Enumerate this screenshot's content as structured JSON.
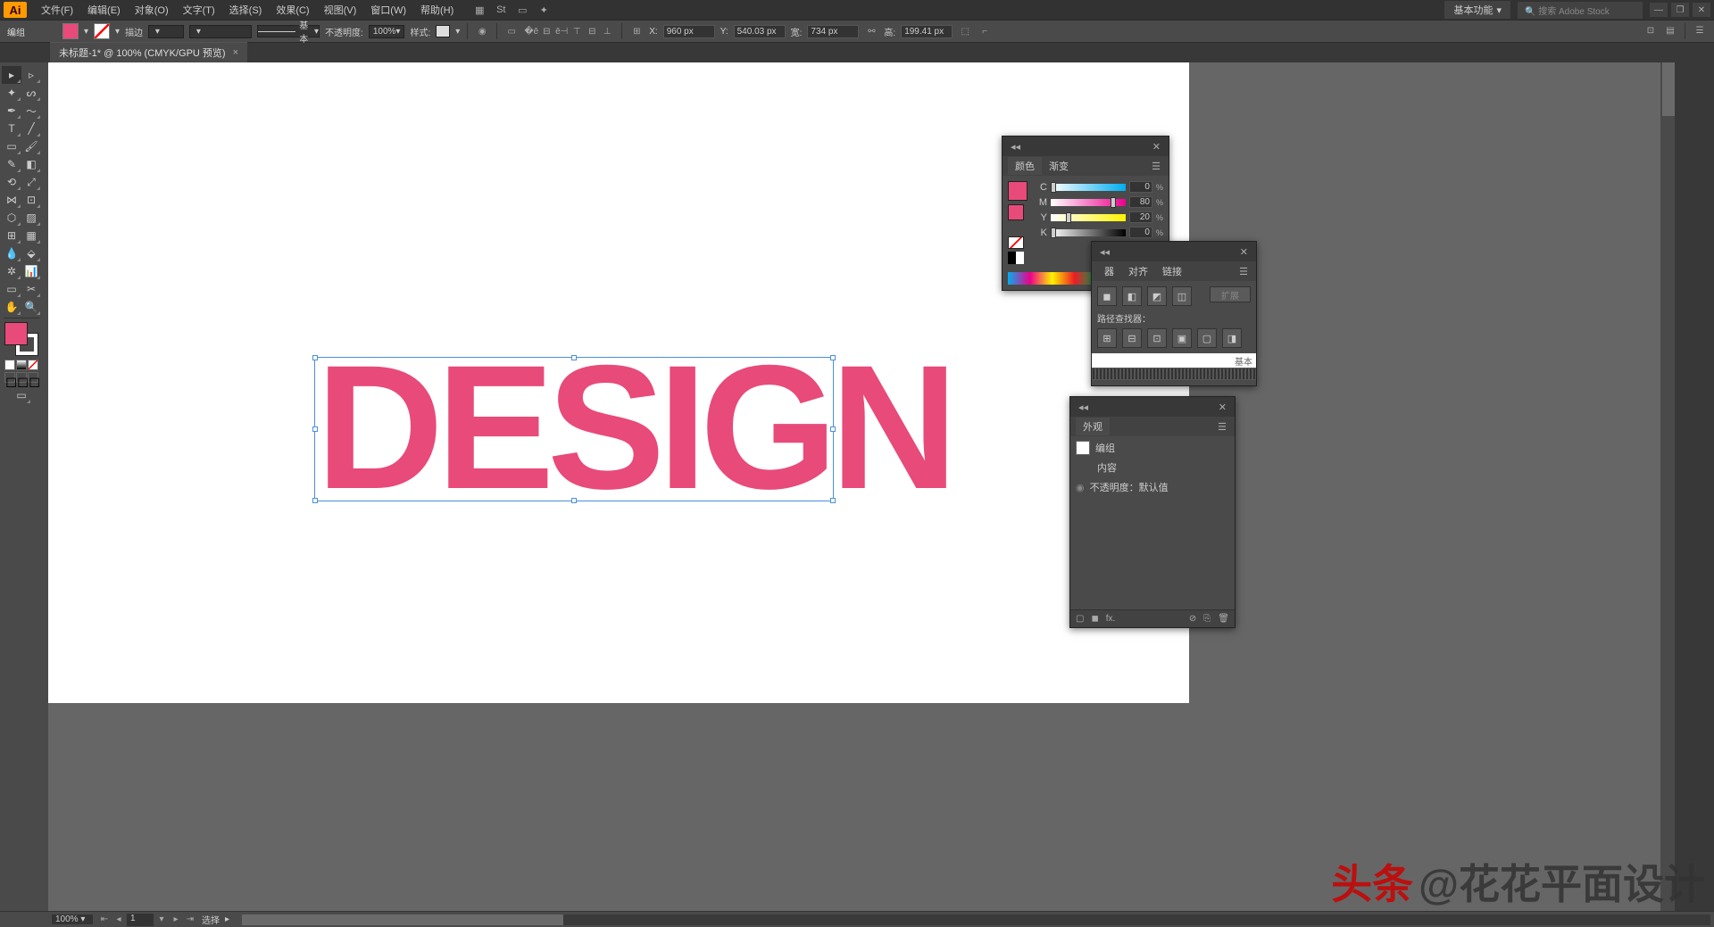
{
  "menubar": {
    "logo": "Ai",
    "items": [
      "文件(F)",
      "编辑(E)",
      "对象(O)",
      "文字(T)",
      "选择(S)",
      "效果(C)",
      "视图(V)",
      "窗口(W)",
      "帮助(H)"
    ],
    "workspace": "基本功能",
    "search_placeholder": "搜索 Adobe Stock"
  },
  "controlbar": {
    "label": "编组",
    "stroke_label": "描边",
    "stroke_profile": "基本",
    "opacity_label": "不透明度:",
    "opacity_value": "100%",
    "style_label": "样式:",
    "x_label": "X:",
    "x_value": "960 px",
    "y_label": "Y:",
    "y_value": "540.03 px",
    "w_label": "宽:",
    "w_value": "734 px",
    "h_label": "高:",
    "h_value": "199.41 px"
  },
  "tab": {
    "title": "未标题-1* @ 100% (CMYK/GPU 预览)"
  },
  "canvas": {
    "text": "DESIGN"
  },
  "color_panel": {
    "tab1": "颜色",
    "tab2": "渐变",
    "channels": [
      {
        "label": "C",
        "value": "0"
      },
      {
        "label": "M",
        "value": "80"
      },
      {
        "label": "Y",
        "value": "20"
      },
      {
        "label": "K",
        "value": "0"
      }
    ]
  },
  "pf_panel": {
    "tab1": "器",
    "tab2": "对齐",
    "tab3": "链接",
    "label": "路径查找器：",
    "expand": "扩展",
    "stroke_basic": "基本"
  },
  "ap_panel": {
    "tab": "外观",
    "row1": "编组",
    "row2": "内容",
    "row3": "不透明度：默认值",
    "fx": "fx."
  },
  "statusbar": {
    "zoom": "100%",
    "artboard": "1",
    "tool": "选择"
  },
  "watermark": {
    "prefix": "头条",
    "text": "@花花平面设计"
  }
}
